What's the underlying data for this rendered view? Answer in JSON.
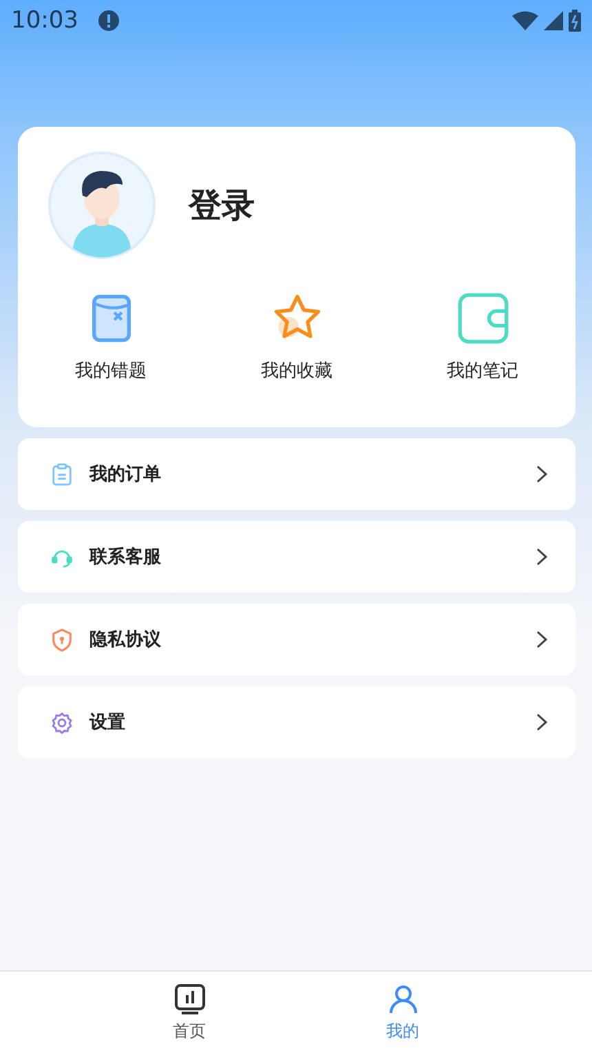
{
  "status_bar": {
    "time": "10:03"
  },
  "profile": {
    "name": "登录"
  },
  "shortcuts": [
    {
      "kind": "mistakes",
      "label": "我的错题"
    },
    {
      "kind": "favorites",
      "label": "我的收藏"
    },
    {
      "kind": "notes",
      "label": "我的笔记"
    }
  ],
  "menu": [
    {
      "kind": "orders",
      "label": "我的订单"
    },
    {
      "kind": "support",
      "label": "联系客服"
    },
    {
      "kind": "privacy",
      "label": "隐私协议"
    },
    {
      "kind": "settings",
      "label": "设置"
    }
  ],
  "tab_bar": [
    {
      "kind": "home",
      "label": "首页",
      "selected": false
    },
    {
      "kind": "mine",
      "label": "我的",
      "selected": true
    }
  ]
}
